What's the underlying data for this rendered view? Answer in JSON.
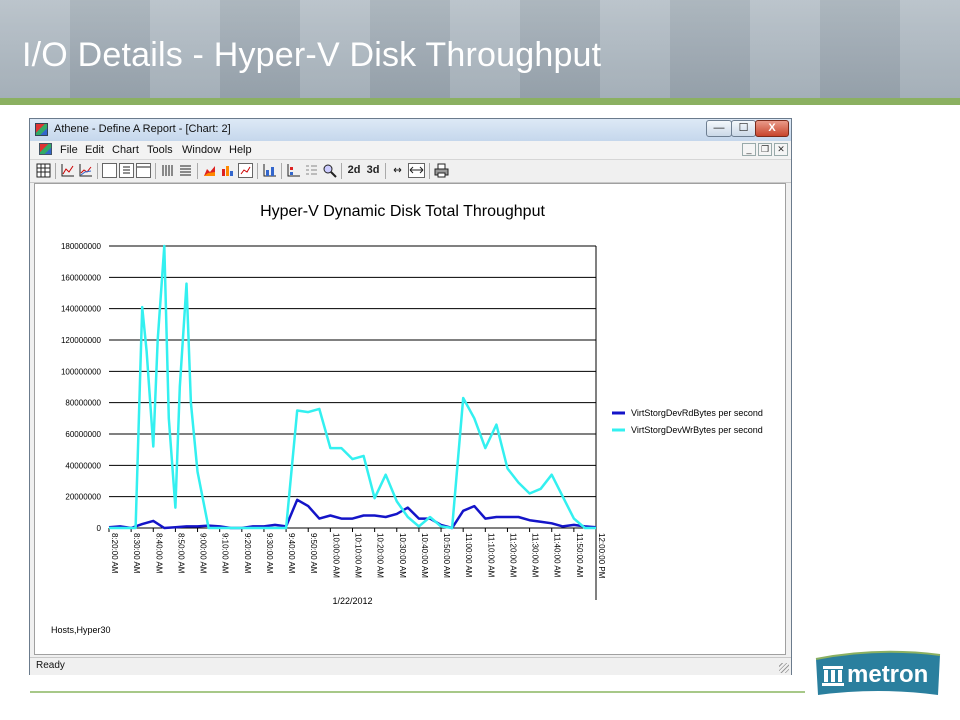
{
  "slide": {
    "title": "I/O Details - Hyper-V Disk Throughput",
    "accent_color": "#8bb061"
  },
  "window": {
    "title": "Athene - Define A Report - [Chart: 2]",
    "controls": {
      "minimize": "—",
      "maximize": "☐",
      "close": "X"
    }
  },
  "menu": {
    "items": [
      "File",
      "Edit",
      "Chart",
      "Tools",
      "Window",
      "Help"
    ],
    "mdi": {
      "minimize": "_",
      "restore": "❐",
      "close": "✕"
    }
  },
  "toolbar": {
    "view_2d": "2d",
    "view_3d": "3d"
  },
  "statusbar": {
    "text": "Ready"
  },
  "chart_data": {
    "type": "line",
    "title": "Hyper-V Dynamic Disk Total Throughput",
    "xlabel": "1/22/2012",
    "ylabel": "",
    "ylim": [
      0,
      180000000
    ],
    "yticks": [
      0,
      20000000,
      40000000,
      60000000,
      80000000,
      100000000,
      120000000,
      140000000,
      160000000,
      180000000
    ],
    "ytick_labels": [
      "0",
      "20000000",
      "40000000",
      "60000000",
      "80000000",
      "100000000",
      "120000000",
      "140000000",
      "160000000",
      "180000000"
    ],
    "xtick_labels": [
      "8:20:00 AM",
      "8:30:00 AM",
      "8:40:00 AM",
      "8:50:00 AM",
      "9:00:00 AM",
      "9:10:00 AM",
      "9:20:00 AM",
      "9:30:00 AM",
      "9:40:00 AM",
      "9:50:00 AM",
      "10:00:00 AM",
      "10:10:00 AM",
      "10:20:00 AM",
      "10:30:00 AM",
      "10:40:00 AM",
      "10:50:00 AM",
      "11:00:00 AM",
      "11:10:00 AM",
      "11:20:00 AM",
      "11:30:00 AM",
      "11:40:00 AM",
      "11:50:00 AM",
      "12:00:00 PM"
    ],
    "x_minutes": [
      500,
      510,
      520,
      530,
      540,
      550,
      560,
      570,
      580,
      590,
      600,
      610,
      620,
      630,
      640,
      650,
      660,
      670,
      680,
      690,
      700,
      710,
      720
    ],
    "grid": true,
    "legend_position": "right",
    "series": [
      {
        "name": "VirtStorgDevRdBytes per second",
        "color": "#1414c8",
        "x": [
          500,
          505,
          510,
          515,
          520,
          525,
          530,
          535,
          540,
          545,
          550,
          555,
          560,
          565,
          570,
          575,
          580,
          585,
          590,
          595,
          600,
          605,
          610,
          615,
          620,
          625,
          630,
          635,
          640,
          645,
          650,
          655,
          660,
          665,
          670,
          675,
          680,
          685,
          690,
          695,
          700,
          705,
          710,
          715,
          720
        ],
        "values": [
          500000,
          1000000,
          0,
          2500000,
          4500000,
          0,
          500000,
          1000000,
          1000000,
          1500000,
          1000000,
          0,
          0,
          1000000,
          1000000,
          2000000,
          1000000,
          18000000,
          14000000,
          6000000,
          8000000,
          6000000,
          6000000,
          8000000,
          8000000,
          7000000,
          9000000,
          13000000,
          6000000,
          6000000,
          2000000,
          0,
          11000000,
          14000000,
          6000000,
          7000000,
          7000000,
          7000000,
          5000000,
          4000000,
          3000000,
          1000000,
          2000000,
          1000000,
          500000
        ]
      },
      {
        "name": "VirtStorgDevWrBytes per second",
        "color": "#33f0f0",
        "x": [
          500,
          505,
          510,
          512,
          515,
          517,
          520,
          522,
          525,
          527,
          530,
          532,
          535,
          537,
          540,
          545,
          550,
          555,
          560,
          565,
          570,
          575,
          580,
          585,
          590,
          595,
          600,
          605,
          610,
          615,
          620,
          625,
          630,
          635,
          640,
          645,
          650,
          655,
          660,
          665,
          670,
          675,
          680,
          685,
          690,
          695,
          700,
          705,
          710,
          715,
          720
        ],
        "values": [
          0,
          0,
          0,
          0,
          141000000,
          113000000,
          52000000,
          120000000,
          180000000,
          70000000,
          13000000,
          90000000,
          156000000,
          80000000,
          36000000,
          0,
          0,
          0,
          0,
          0,
          0,
          0,
          0,
          75000000,
          74000000,
          76000000,
          51000000,
          51000000,
          44000000,
          46000000,
          19000000,
          34000000,
          17000000,
          7000000,
          1000000,
          7000000,
          1000000,
          0,
          83000000,
          70000000,
          51000000,
          66000000,
          38000000,
          29000000,
          22000000,
          25000000,
          34000000,
          20000000,
          6000000,
          0,
          0
        ]
      }
    ],
    "footnote": "Hosts,Hyper30"
  },
  "logo": {
    "text": "metron",
    "color": "#2a7f9e"
  }
}
